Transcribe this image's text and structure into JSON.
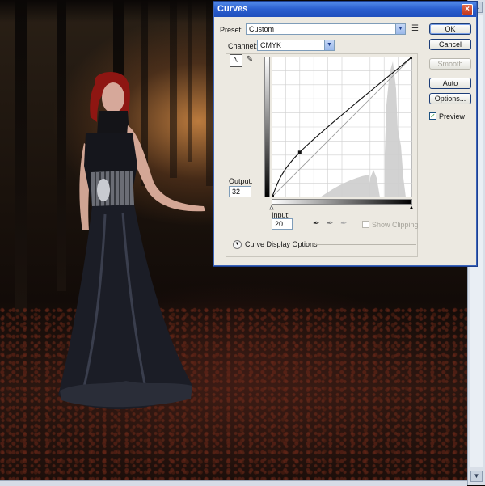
{
  "dialog": {
    "title": "Curves",
    "close_glyph": "×",
    "preset": {
      "label": "Preset:",
      "value": "Custom"
    },
    "channel": {
      "label": "Channel:",
      "value": "CMYK"
    },
    "buttons": {
      "ok": "OK",
      "cancel": "Cancel",
      "smooth": "Smooth",
      "auto": "Auto",
      "options": "Options..."
    },
    "preview": {
      "label": "Preview",
      "checked": true
    },
    "output": {
      "label": "Output:",
      "value": "32"
    },
    "input": {
      "label": "Input:",
      "value": "20"
    },
    "show_clipping": {
      "label": "Show Clipping",
      "checked": false
    },
    "curve_display_options": "Curve Display Options",
    "curve_points": [
      {
        "input": 0,
        "output": 0
      },
      {
        "input": 20,
        "output": 32
      },
      {
        "input": 100,
        "output": 100
      }
    ]
  },
  "icons": {
    "close": "close-icon",
    "preset_menu": "preset-menu-icon",
    "curve_tool": "curve-tool-icon",
    "pencil_tool": "pencil-tool-icon",
    "black_eyedropper": "black-eyedropper-icon",
    "gray_eyedropper": "gray-eyedropper-icon",
    "white_eyedropper": "white-eyedropper-icon",
    "expand": "expand-chevron-icon"
  },
  "colors": {
    "titlebar": "#2b5fcf",
    "dialog_bg": "#ece9e1",
    "preview_check": "#218a21"
  }
}
